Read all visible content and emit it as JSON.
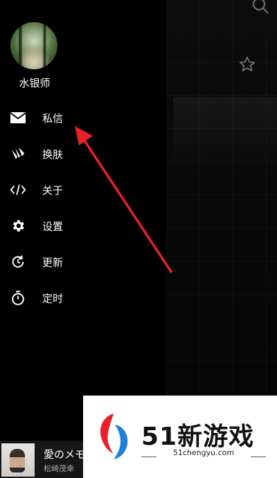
{
  "user": {
    "name": "水银师"
  },
  "menu": {
    "items": [
      {
        "label": "私信",
        "icon": "mail-icon"
      },
      {
        "label": "换肤",
        "icon": "skin-icon"
      },
      {
        "label": "关于",
        "icon": "code-icon"
      },
      {
        "label": "设置",
        "icon": "gear-icon"
      },
      {
        "label": "更新",
        "icon": "refresh-icon"
      },
      {
        "label": "定时",
        "icon": "timer-icon"
      }
    ]
  },
  "player": {
    "title": "愛のメモ",
    "artist": "松崎茂幸"
  },
  "watermark": {
    "name": "51新游戏",
    "url": "51chengyu.com"
  },
  "colors": {
    "arrow": "#e8202a",
    "background": "#000000",
    "text": "#ffffff"
  }
}
